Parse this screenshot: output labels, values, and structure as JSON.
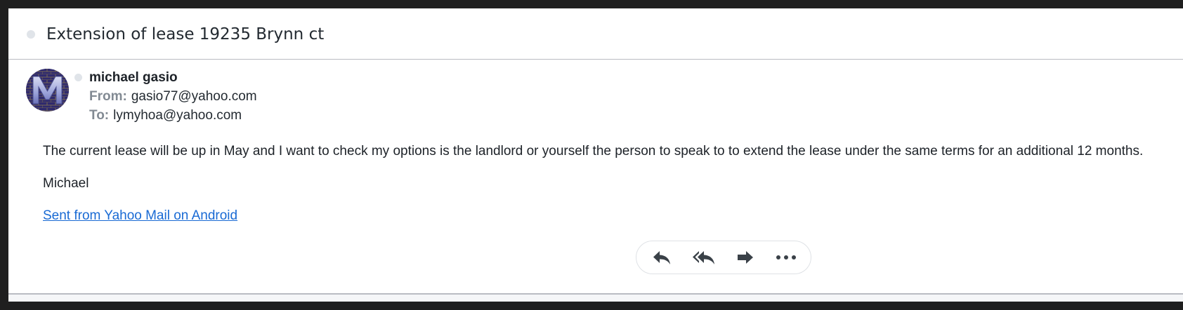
{
  "thread": {
    "subject": "Extension of lease 19235 Brynn ct"
  },
  "message": {
    "avatar_icon": "sender-avatar-m-logo",
    "sender_name": "michael gasio",
    "from_label": "From:",
    "from_address": "gasio77@yahoo.com",
    "to_label": "To:",
    "to_address": "lymyhoa@yahoo.com",
    "body": [
      "The current lease will be up in May and I want to check my options is the landlord or yourself the person to speak to to extend the lease under the same terms for an additional 12 months.",
      "Michael"
    ],
    "signature_link": "Sent from Yahoo Mail on Android"
  },
  "actions": {
    "buttons": [
      {
        "name": "reply",
        "icon": "reply-icon"
      },
      {
        "name": "reply-all",
        "icon": "reply-all-icon"
      },
      {
        "name": "forward",
        "icon": "forward-icon"
      },
      {
        "name": "more",
        "icon": "more-icon"
      }
    ]
  },
  "colors": {
    "link": "#196ad4",
    "icon": "#3a4148",
    "label": "#828a93",
    "text": "#1d2228"
  }
}
